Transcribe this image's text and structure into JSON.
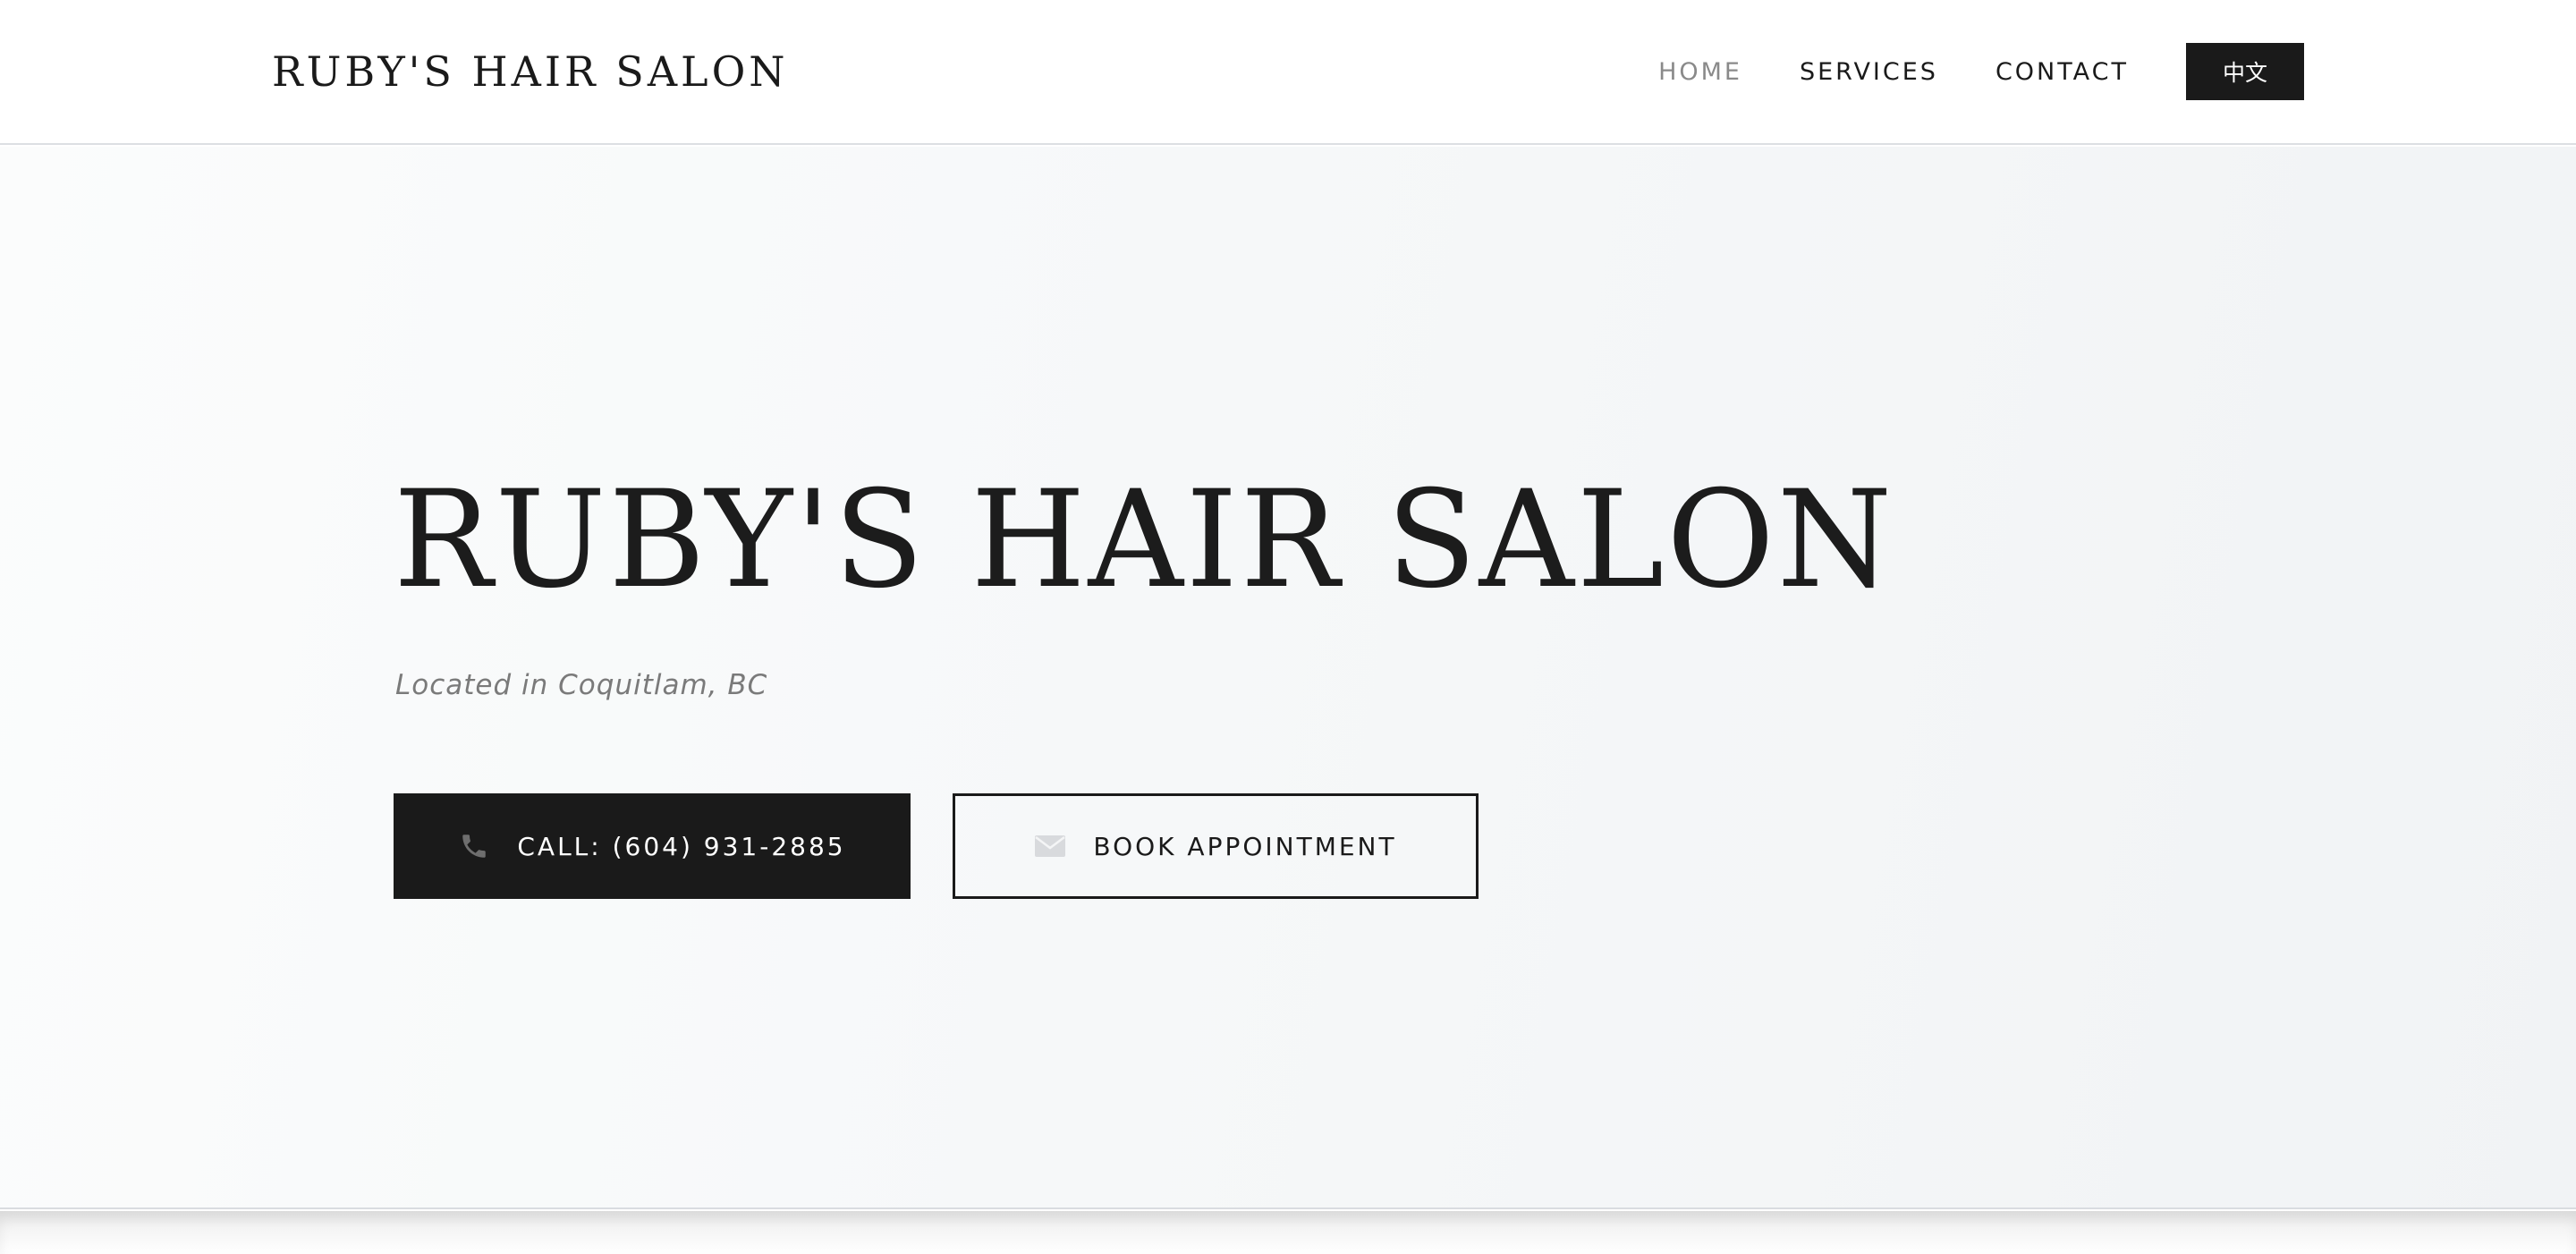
{
  "header": {
    "brand": "RUBY'S HAIR SALON",
    "nav": [
      {
        "label": "HOME",
        "active": true
      },
      {
        "label": "SERVICES",
        "active": false
      },
      {
        "label": "CONTACT",
        "active": false
      }
    ],
    "language_button": "中文"
  },
  "hero": {
    "title": "RUBY'S HAIR SALON",
    "subtitle": "Located in Coquitlam, BC",
    "call_button": {
      "label": "CALL: (604) 931-2885",
      "icon": "phone-icon"
    },
    "book_button": {
      "label": "BOOK APPOINTMENT",
      "icon": "envelope-icon"
    }
  },
  "colors": {
    "ink": "#1a1a1a",
    "nav_active": "#8a8a8a",
    "subtitle": "#7a7a7a",
    "hero_bg": "#f6f8f9"
  }
}
